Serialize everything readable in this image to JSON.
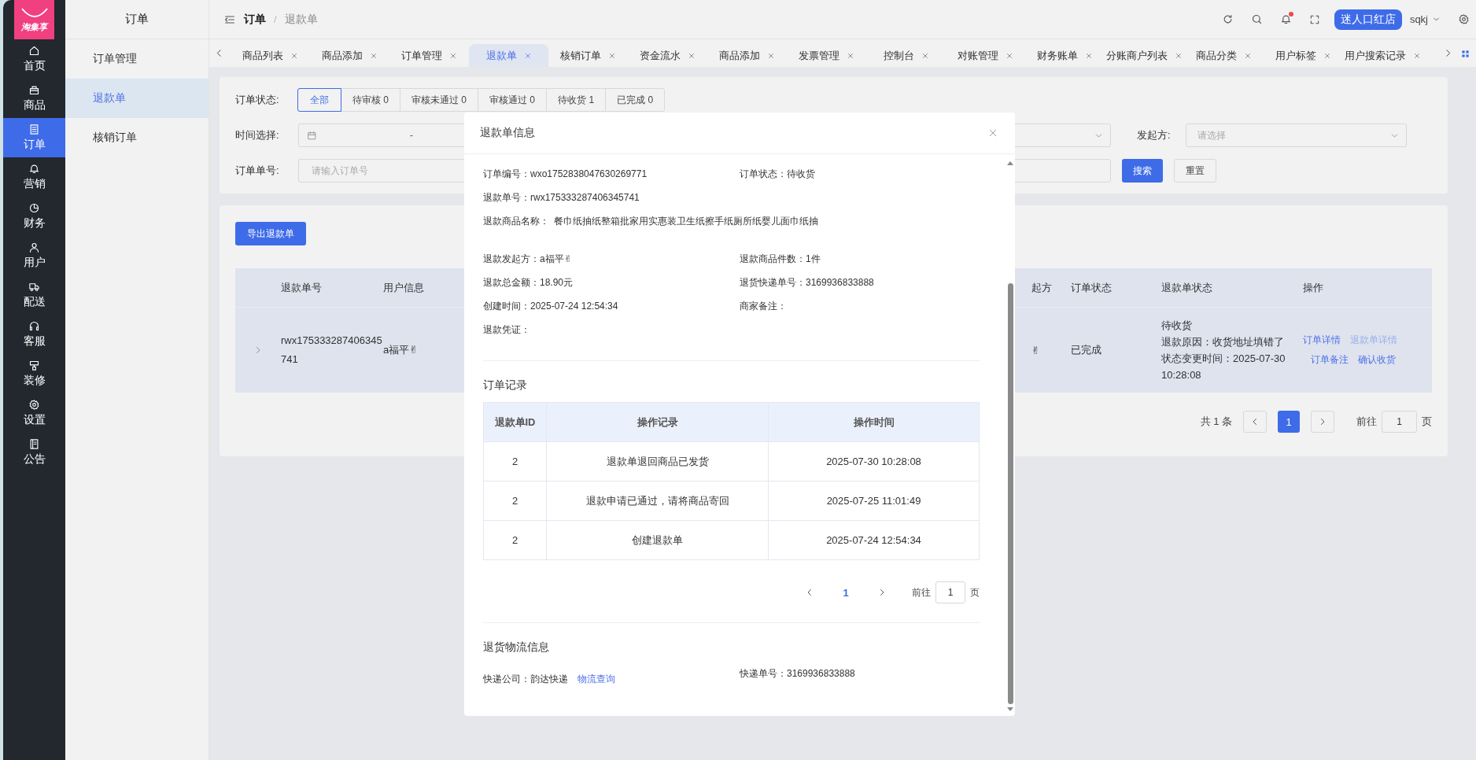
{
  "rail": {
    "logo": "淘集享",
    "items": [
      {
        "label": "首页",
        "selected": false
      },
      {
        "label": "商品",
        "selected": false
      },
      {
        "label": "订单",
        "selected": true
      },
      {
        "label": "营销",
        "selected": false
      },
      {
        "label": "财务",
        "selected": false
      },
      {
        "label": "用户",
        "selected": false
      },
      {
        "label": "配送",
        "selected": false
      },
      {
        "label": "客服",
        "selected": false
      },
      {
        "label": "装修",
        "selected": false
      },
      {
        "label": "设置",
        "selected": false
      },
      {
        "label": "公告",
        "selected": false
      }
    ]
  },
  "subnav": {
    "title": "订单",
    "items": [
      {
        "label": "订单管理",
        "selected": false
      },
      {
        "label": "退款单",
        "selected": true
      },
      {
        "label": "核销订单",
        "selected": false
      }
    ]
  },
  "topbar": {
    "breadcrumb": [
      "订单",
      "退款单"
    ],
    "breadcrumb_separator": "/",
    "notification_dot": true,
    "shop_button": "迷人口红店",
    "user": "sqkj"
  },
  "tabs": [
    {
      "label": "商品列表",
      "selected": false
    },
    {
      "label": "商品添加",
      "selected": false
    },
    {
      "label": "订单管理",
      "selected": false
    },
    {
      "label": "退款单",
      "selected": true
    },
    {
      "label": "核销订单",
      "selected": false
    },
    {
      "label": "资金流水",
      "selected": false
    },
    {
      "label": "商品添加",
      "selected": false
    },
    {
      "label": "发票管理",
      "selected": false
    },
    {
      "label": "控制台",
      "selected": false
    },
    {
      "label": "对账管理",
      "selected": false
    },
    {
      "label": "财务账单",
      "selected": false
    },
    {
      "label": "分账商户列表",
      "selected": false
    },
    {
      "label": "商品分类",
      "selected": false
    },
    {
      "label": "用户标签",
      "selected": false
    },
    {
      "label": "用户搜索记录",
      "selected": false
    }
  ],
  "filters": {
    "status_label": "订单状态:",
    "status_options": [
      {
        "label": "全部",
        "selected": true
      },
      {
        "label": "待审核 0",
        "selected": false
      },
      {
        "label": "审核未通过 0",
        "selected": false
      },
      {
        "label": "审核通过 0",
        "selected": false
      },
      {
        "label": "待收货 1",
        "selected": false
      },
      {
        "label": "已完成 0",
        "selected": false
      }
    ],
    "time_label": "时间选择:",
    "date_separator": "-",
    "initiator_label": "发起方:",
    "initiator_placeholder": "请选择",
    "order_no_label": "订单单号:",
    "order_no_placeholder": "请输入订单号",
    "search_button": "搜索",
    "reset_button": "重置"
  },
  "export_button": "导出退款单",
  "table": {
    "columns": [
      "退款单号",
      "用户信息",
      "起方",
      "订单状态",
      "退款单状态",
      "操作"
    ],
    "rows": [
      {
        "refund_no": "rwx175333287406345741",
        "user": "a福平✌",
        "column_3": "✌",
        "order_status": "已完成",
        "refund_status": [
          "待收货",
          "退款原因：收货地址填错了",
          "状态变更时间：2025-07-30 10:28:08"
        ],
        "actions": [
          {
            "label": "订单详情",
            "disabled": false
          },
          {
            "label": "退款单详情",
            "disabled": true
          },
          {
            "label": "订单备注",
            "disabled": false
          },
          {
            "label": "确认收货",
            "disabled": false
          }
        ]
      }
    ]
  },
  "pagination": {
    "total": "共 1 条",
    "pages": [
      {
        "label": "1",
        "selected": true
      }
    ],
    "goto_label": "前往",
    "goto_value": "1",
    "suffix": "页"
  },
  "modal": {
    "title": "退款单信息",
    "info_groups": [
      [
        [
          {
            "label": "订单编号：",
            "value": "wxo1752838047630269771"
          },
          {
            "label": "订单状态：",
            "value": "待收货"
          }
        ],
        [
          {
            "label": "退款单号：",
            "value": "rwx175333287406345741"
          }
        ],
        [
          {
            "label": "退款商品名称：",
            "value": "餐巾纸抽纸整箱批家用实惠装卫生纸擦手纸厕所纸婴儿面巾纸抽"
          }
        ]
      ],
      [
        [
          {
            "label": "退款发起方：",
            "value": "a福平✌"
          },
          {
            "label": "退款商品件数：",
            "value": "1件"
          }
        ],
        [
          {
            "label": "退款总金额：",
            "value": "18.90元"
          },
          {
            "label": "退货快递单号：",
            "value": "3169936833888"
          }
        ],
        [
          {
            "label": "创建时间：",
            "value": "2025-07-24 12:54:34"
          },
          {
            "label": "商家备注："
          }
        ],
        [
          {
            "label": "退款凭证："
          }
        ]
      ]
    ],
    "records": {
      "title": "订单记录",
      "columns": [
        "退款单ID",
        "操作记录",
        "操作时间"
      ],
      "rows": [
        [
          "2",
          "退款单退回商品已发货",
          "2025-07-30 10:28:08"
        ],
        [
          "2",
          "退款申请已通过，请将商品寄回",
          "2025-07-25 11:01:49"
        ],
        [
          "2",
          "创建退款单",
          "2025-07-24 12:54:34"
        ]
      ],
      "pagination": {
        "pages": [
          {
            "label": "1",
            "selected": true
          }
        ],
        "goto_label": "前往",
        "goto_value": "1",
        "suffix": "页"
      }
    },
    "logistics": {
      "title": "退货物流信息",
      "company_label": "快递公司：",
      "company": "韵达快递",
      "track_link": "物流查询",
      "tracking": "快递单号：3169936833888"
    }
  }
}
